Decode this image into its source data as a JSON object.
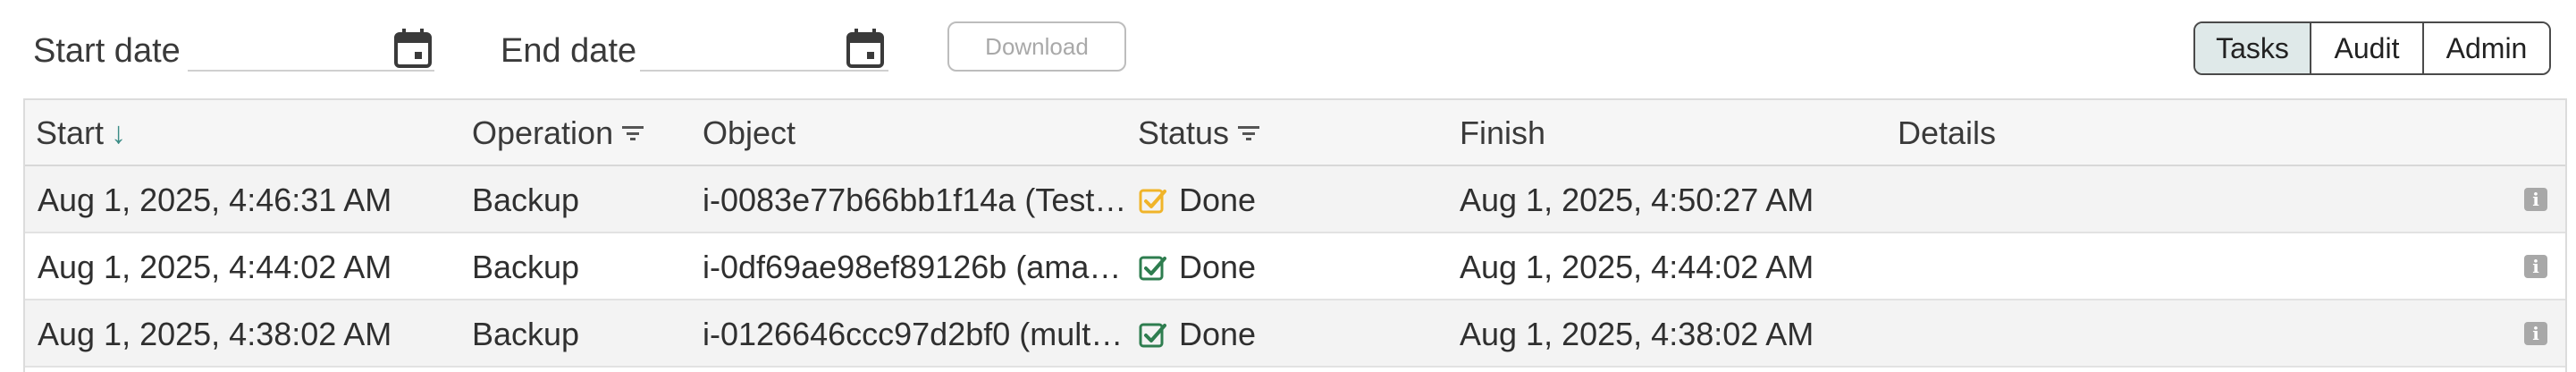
{
  "filters": {
    "start_date_label": "Start date",
    "start_date_value": "",
    "end_date_label": "End date",
    "end_date_value": "",
    "download_label": "Download"
  },
  "view_tabs": [
    {
      "label": "Tasks",
      "active": true
    },
    {
      "label": "Audit",
      "active": false
    },
    {
      "label": "Admin",
      "active": false
    }
  ],
  "table": {
    "columns": {
      "start": "Start",
      "operation": "Operation",
      "object": "Object",
      "status": "Status",
      "finish": "Finish",
      "details": "Details"
    },
    "sort": {
      "column": "start",
      "direction": "descending"
    },
    "rows": [
      {
        "start": "Aug 1, 2025, 4:46:31 AM",
        "operation": "Backup",
        "object": "i-0083e77b66bb1f14a (Test…",
        "status": "Done",
        "status_icon": "warning-check-icon",
        "status_color": "#f0b429",
        "finish": "Aug 1, 2025, 4:50:27 AM",
        "details": ""
      },
      {
        "start": "Aug 1, 2025, 4:44:02 AM",
        "operation": "Backup",
        "object": "i-0df69ae98ef89126b (ama…",
        "status": "Done",
        "status_icon": "success-check-icon",
        "status_color": "#2e7d4f",
        "finish": "Aug 1, 2025, 4:44:02 AM",
        "details": ""
      },
      {
        "start": "Aug 1, 2025, 4:38:02 AM",
        "operation": "Backup",
        "object": "i-0126646ccc97d2bf0 (mult…",
        "status": "Done",
        "status_icon": "success-check-icon",
        "status_color": "#2e7d4f",
        "finish": "Aug 1, 2025, 4:38:02 AM",
        "details": ""
      }
    ]
  },
  "colors": {
    "accent": "#3b8c86",
    "active_tab_bg": "#dfe9e9",
    "warning": "#f0b429",
    "success": "#2e7d4f"
  }
}
